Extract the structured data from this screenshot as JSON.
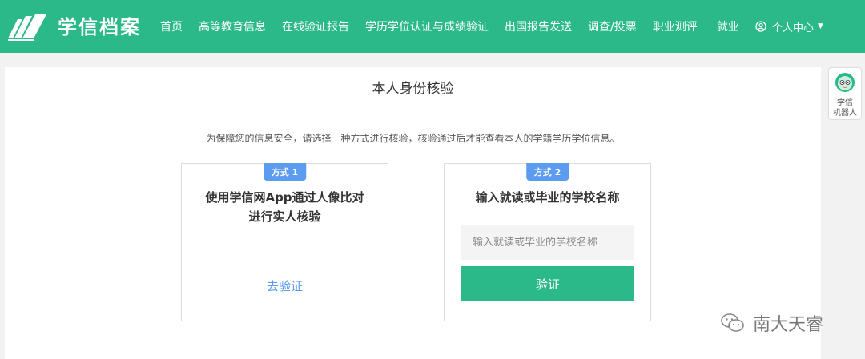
{
  "header": {
    "logo_text": "学信档案",
    "nav": [
      "首页",
      "高等教育信息",
      "在线验证报告",
      "学历学位认证与成绩验证",
      "出国报告发送",
      "调查/投票",
      "职业测评",
      "就业"
    ],
    "user_center": "个人中心"
  },
  "page": {
    "title": "本人身份核验",
    "notice": "为保障您的信息安全，请选择一种方式进行核验，核验通过后才能查看本人的学籍学历学位信息。"
  },
  "option1": {
    "badge": "方式 1",
    "title_line1": "使用学信网App通过人像比对",
    "title_line2": "进行实人核验",
    "link": "去验证"
  },
  "option2": {
    "badge": "方式 2",
    "title": "输入就读或毕业的学校名称",
    "placeholder": "输入就读或毕业的学校名称",
    "button": "验证"
  },
  "robot": {
    "line1": "学信",
    "line2": "机器人"
  },
  "watermark": "南大天睿",
  "colors": {
    "brand": "#2bb989",
    "link": "#5b9bf0"
  }
}
